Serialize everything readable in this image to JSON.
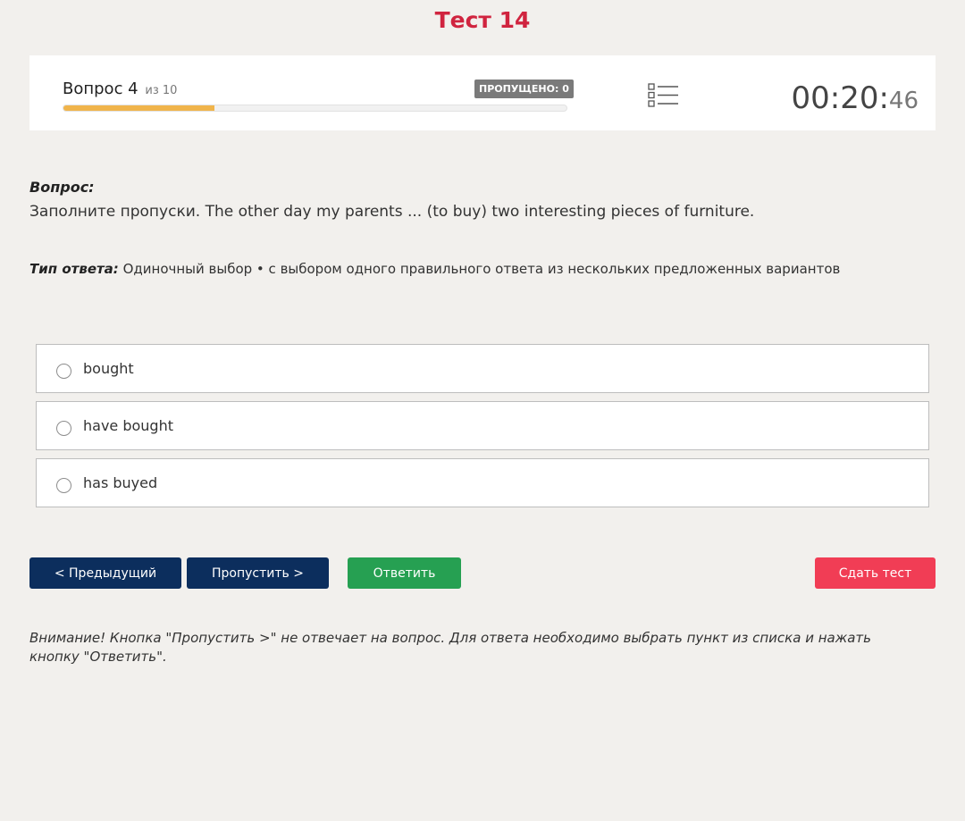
{
  "page": {
    "title": "Тест 14"
  },
  "header": {
    "question_prefix": "Вопрос 4",
    "question_of": "из 10",
    "skipped_badge": "ПРОПУЩЕНО: 0",
    "progress_fraction": 0.3,
    "list_icon": "list-icon",
    "timer_main": "00:20:",
    "timer_seconds": "46"
  },
  "question": {
    "heading": "Вопрос:",
    "text": "Заполните пропуски. The other day my parents ... (to buy) two interesting pieces of furniture.",
    "answer_type_label": "Тип ответа:",
    "answer_type_value": "Одиночный выбор • с выбором одного правильного ответа из нескольких предложенных вариантов"
  },
  "options": [
    {
      "label": "bought"
    },
    {
      "label": "have bought"
    },
    {
      "label": "has buyed"
    }
  ],
  "buttons": {
    "prev": "< Предыдущий",
    "skip": "Пропустить >",
    "answer": "Ответить",
    "submit": "Сдать тест"
  },
  "warning": "Внимание! Кнопка \"Пропустить >\" не отвечает на вопрос. Для ответа необходимо выбрать пункт из списка и нажать кнопку \"Ответить\".",
  "colors": {
    "title": "#d0243f",
    "nav_button": "#0c2e5d",
    "answer_button": "#26a052",
    "submit_button": "#f13d55",
    "progress": "#f0b44b"
  }
}
